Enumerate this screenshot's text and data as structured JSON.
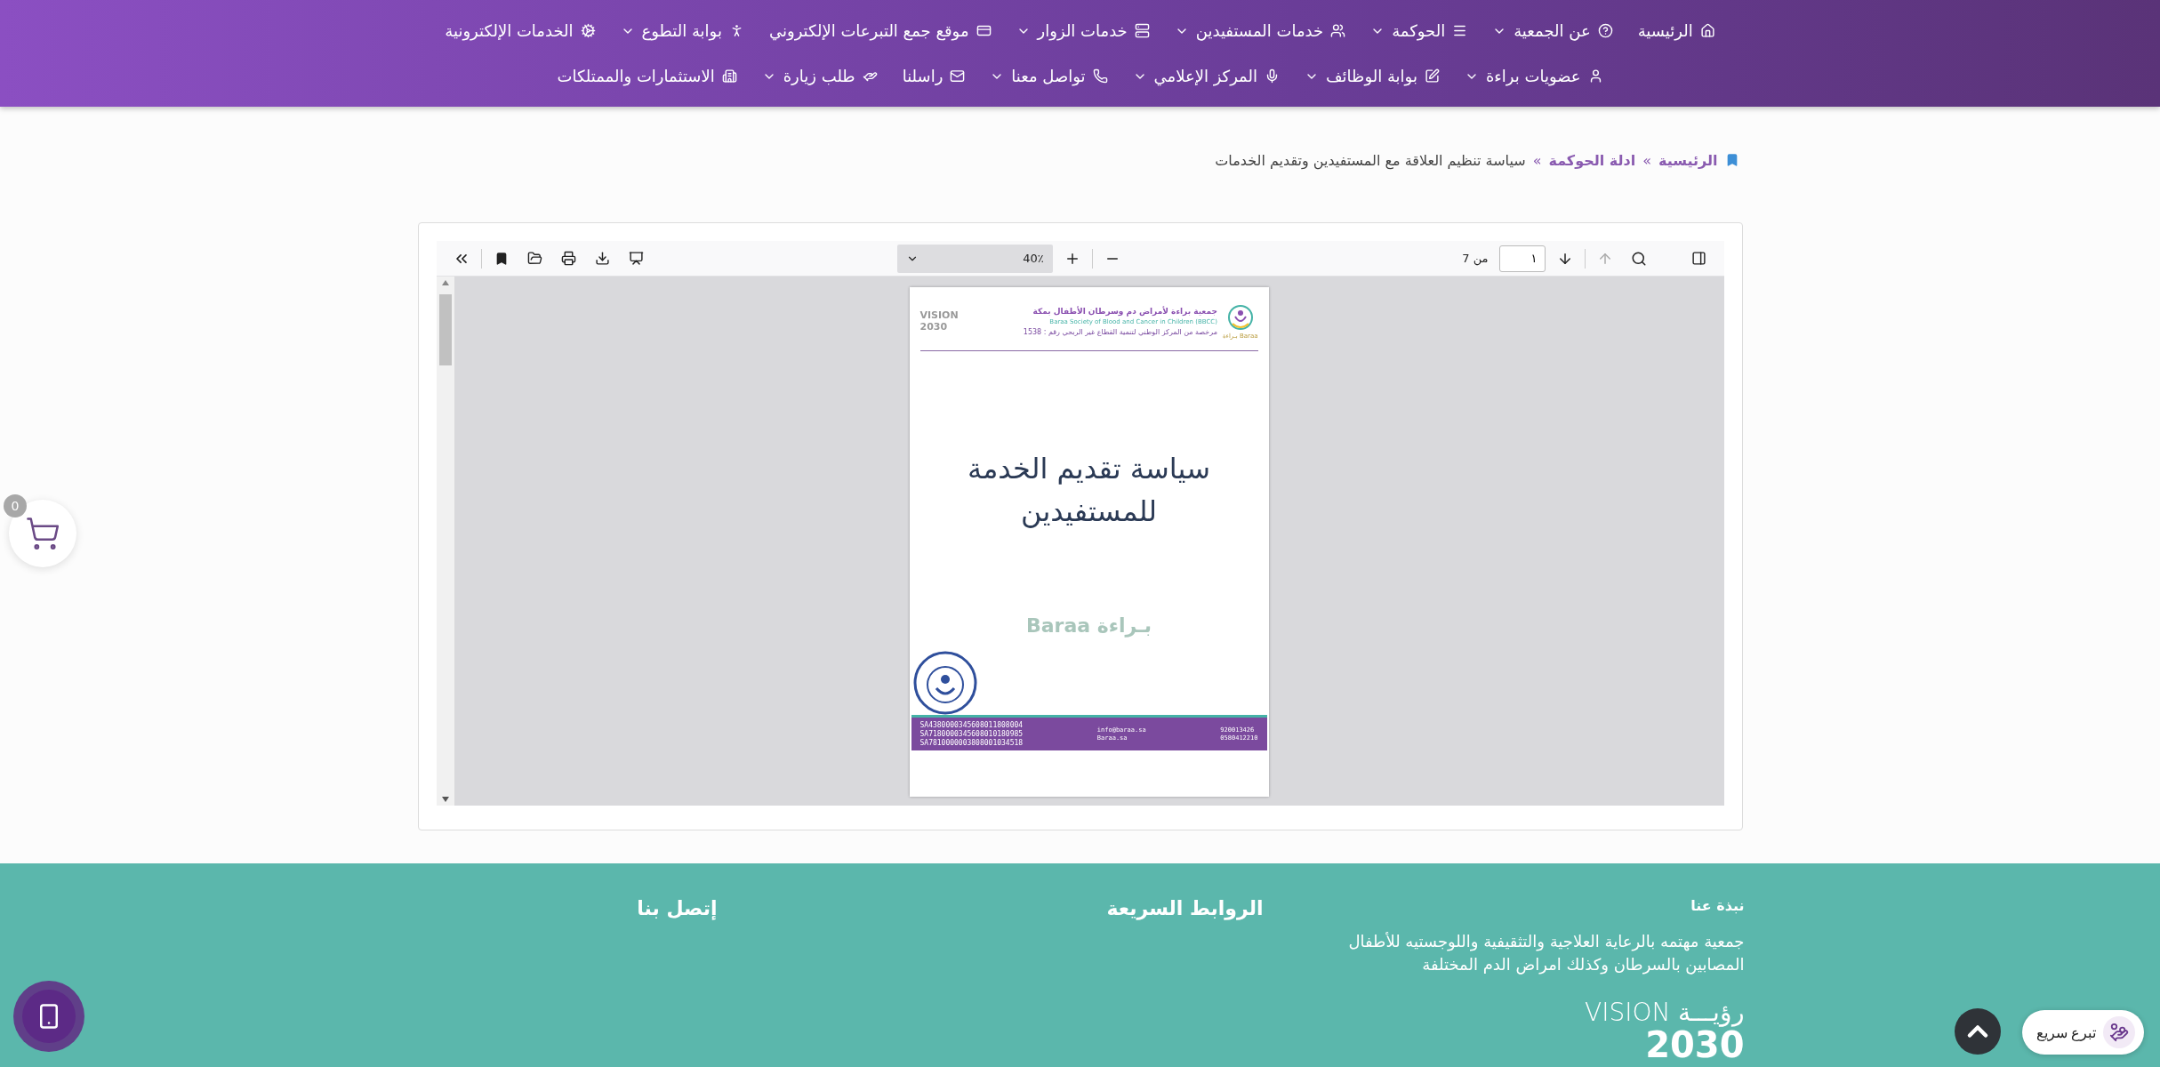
{
  "nav": {
    "rows": [
      {
        "items": [
          {
            "label": "الرئيسية",
            "dropdown": false
          },
          {
            "label": "عن الجمعية",
            "dropdown": true
          },
          {
            "label": "الحوكمة",
            "dropdown": true
          },
          {
            "label": "خدمات المستفيدين",
            "dropdown": true
          },
          {
            "label": "خدمات الزوار",
            "dropdown": true
          },
          {
            "label": "موقع جمع التبرعات الإلكتروني",
            "dropdown": false
          },
          {
            "label": "بوابة التطوع",
            "dropdown": true
          },
          {
            "label": "الخدمات الإلكترونية",
            "dropdown": false
          }
        ]
      },
      {
        "items": [
          {
            "label": "عضويات براءة",
            "dropdown": true
          },
          {
            "label": "بوابة الوظائف",
            "dropdown": true
          },
          {
            "label": "المركز الإعلامي",
            "dropdown": true
          },
          {
            "label": "تواصل معنا",
            "dropdown": true
          },
          {
            "label": "راسلنا",
            "dropdown": false
          },
          {
            "label": "طلب زيارة",
            "dropdown": true
          },
          {
            "label": "الاستثمارات والممتلكات",
            "dropdown": false
          }
        ]
      }
    ]
  },
  "breadcrumb": [
    {
      "kind": "link",
      "text": "الرئيسية"
    },
    {
      "kind": "separator",
      "text": "»"
    },
    {
      "kind": "link",
      "text": "ادلة الحوكمة"
    },
    {
      "kind": "separator",
      "text": "»"
    },
    {
      "kind": "current",
      "text": "سياسة تنظيم العلاقة مع المستفيدين وتقديم الخدمات"
    }
  ],
  "pdf_viewer": {
    "zoom": "40٪",
    "page_input": "١",
    "page_total": "من 7",
    "document": {
      "org_name_ar": "جمعية براءة لأمراض دم وسرطان الأطفال بمكة",
      "org_name_en": "Baraa Society of Blood and Cancer in Children (BBCC)",
      "license": "مرخصة من المركز الوطني لتنمية القطاع غير الربحي رقم : 1538",
      "logo_text": "بـراءة Baraa",
      "vision": "VISION 2030",
      "title_lines": [
        "سياسة تقديم الخدمة",
        "للمستفيدين"
      ],
      "watermark": "بـراءة Baraa",
      "bank_accounts": [
        "SA4380000345608011808004",
        "SA7180000345608010180985",
        "SA7810000003808001034518"
      ],
      "web": [
        "info@baraa.sa",
        "Baraa.sa"
      ],
      "phones": [
        "920013426",
        "0580412210"
      ]
    }
  },
  "footer": {
    "about": {
      "title": "نبذة عنا",
      "text": "جمعية مهتمه بالرعاية العلاجية والتثقيفية واللوجستيه للأطفال المصابين بالسرطان وكذلك امراض الدم المختلفة"
    },
    "quick_links": {
      "title": "الروابط السريعة"
    },
    "contact": {
      "title": "إتصل بنا"
    },
    "vision": {
      "latin": "VISION",
      "arabic": "رؤيـــة",
      "year": "2030"
    }
  },
  "cart": {
    "count": "0"
  },
  "quick_donate": {
    "label": "تبرع سريع"
  }
}
